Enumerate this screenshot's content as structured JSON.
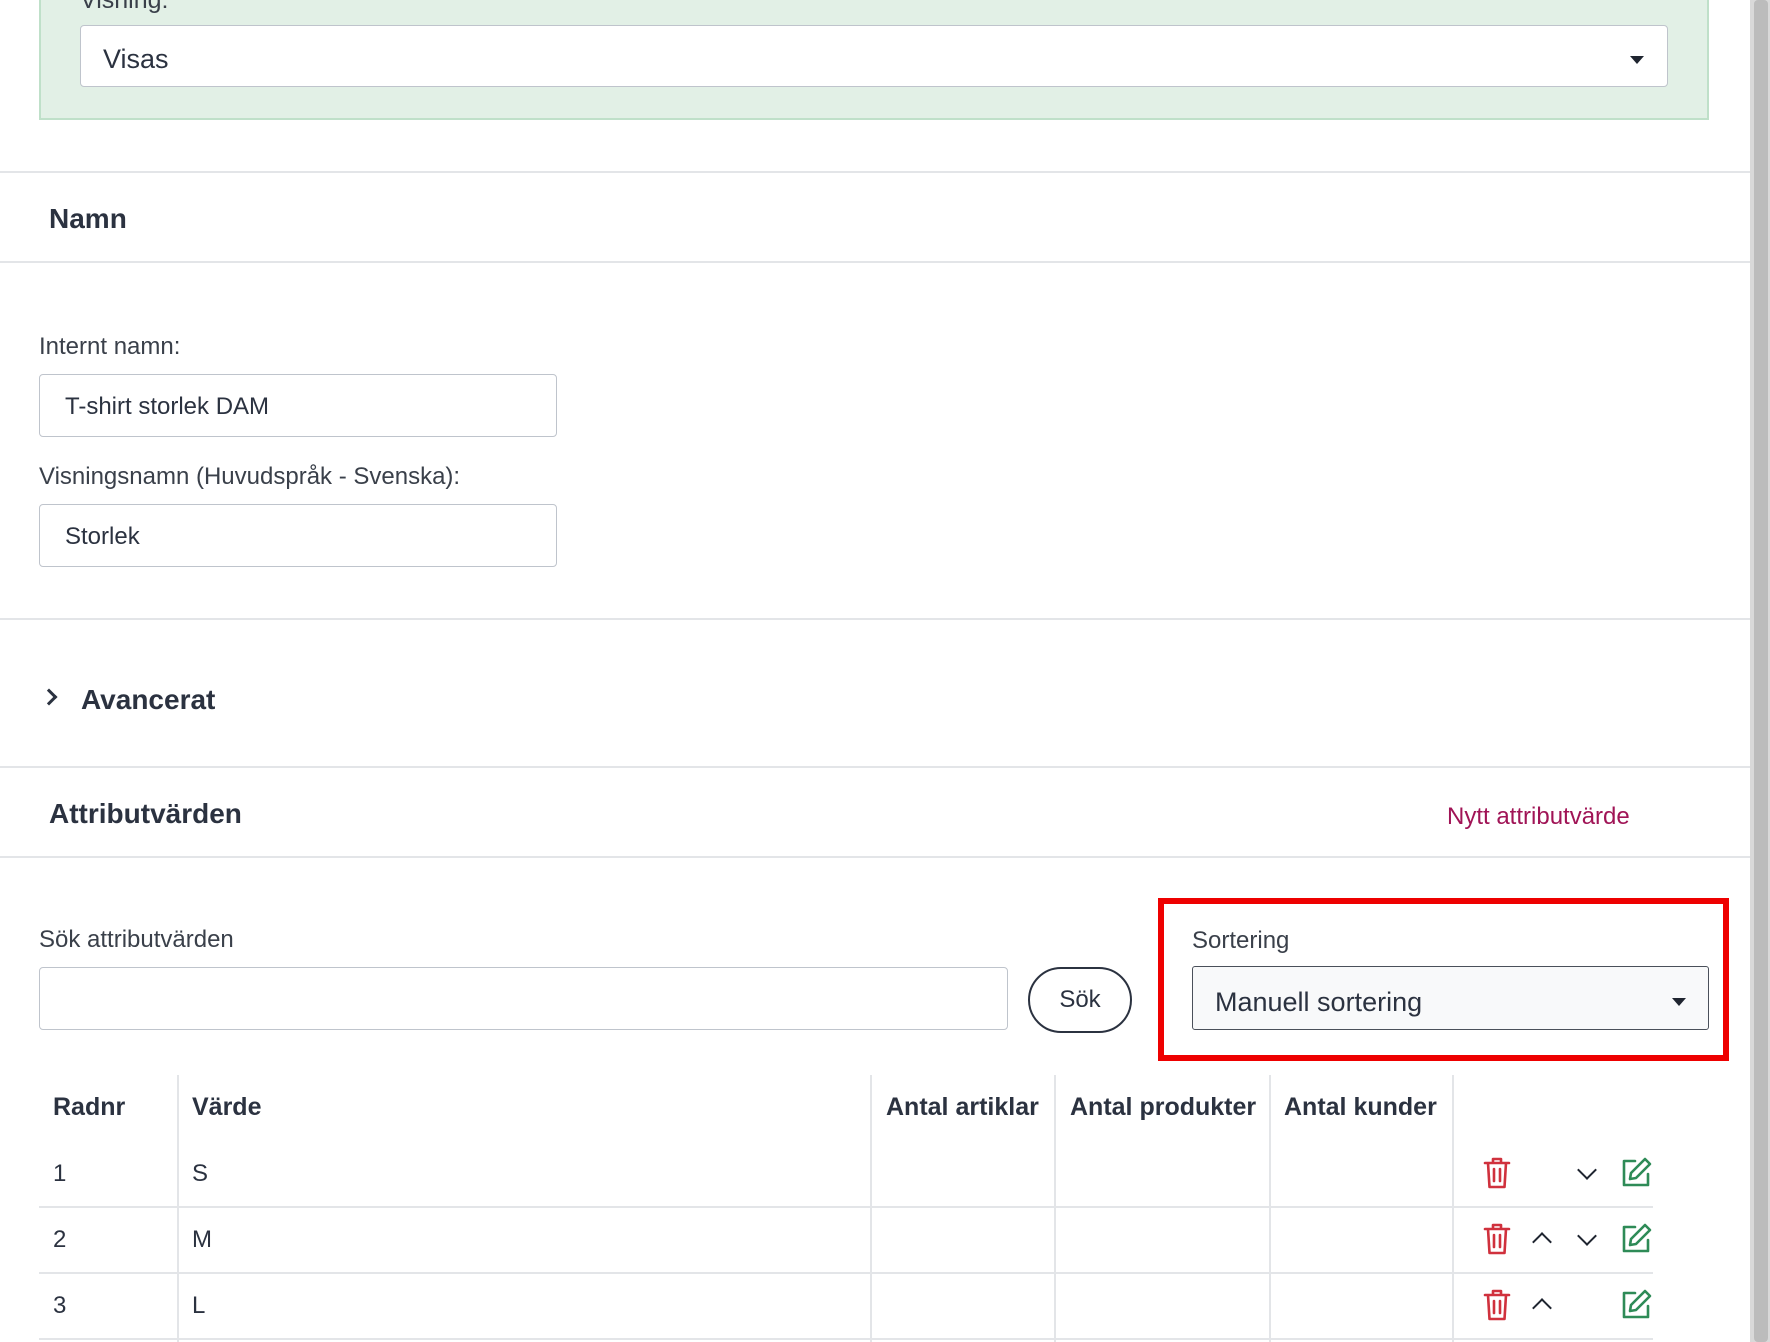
{
  "visning": {
    "label": "Visning:",
    "selected": "Visas"
  },
  "namn_section": {
    "title": "Namn",
    "internal_name_label": "Internt namn:",
    "internal_name_value": "T-shirt storlek DAM",
    "display_name_label": "Visningsnamn (Huvudspråk - Svenska):",
    "display_name_value": "Storlek"
  },
  "avancerat": {
    "title": "Avancerat"
  },
  "attribut_section": {
    "title": "Attributvärden",
    "new_link": "Nytt attributvärde",
    "search_label": "Sök attributvärden",
    "search_value": "",
    "search_button": "Sök",
    "sort_label": "Sortering",
    "sort_selected": "Manuell sortering"
  },
  "table": {
    "headers": [
      "Radnr",
      "Värde",
      "Antal artiklar",
      "Antal produkter",
      "Antal kunder"
    ],
    "rows": [
      {
        "radnr": "1",
        "varde": "S"
      },
      {
        "radnr": "2",
        "varde": "M"
      },
      {
        "radnr": "3",
        "varde": "L"
      }
    ]
  },
  "colors": {
    "accent_link": "#a01456",
    "delete_icon": "#d0313d",
    "edit_icon": "#2e8b57",
    "highlight": "#ee0000"
  },
  "icons": {
    "delete": "trash-icon",
    "move_up": "chevron-up-icon",
    "move_down": "chevron-down-icon",
    "edit": "edit-icon"
  }
}
